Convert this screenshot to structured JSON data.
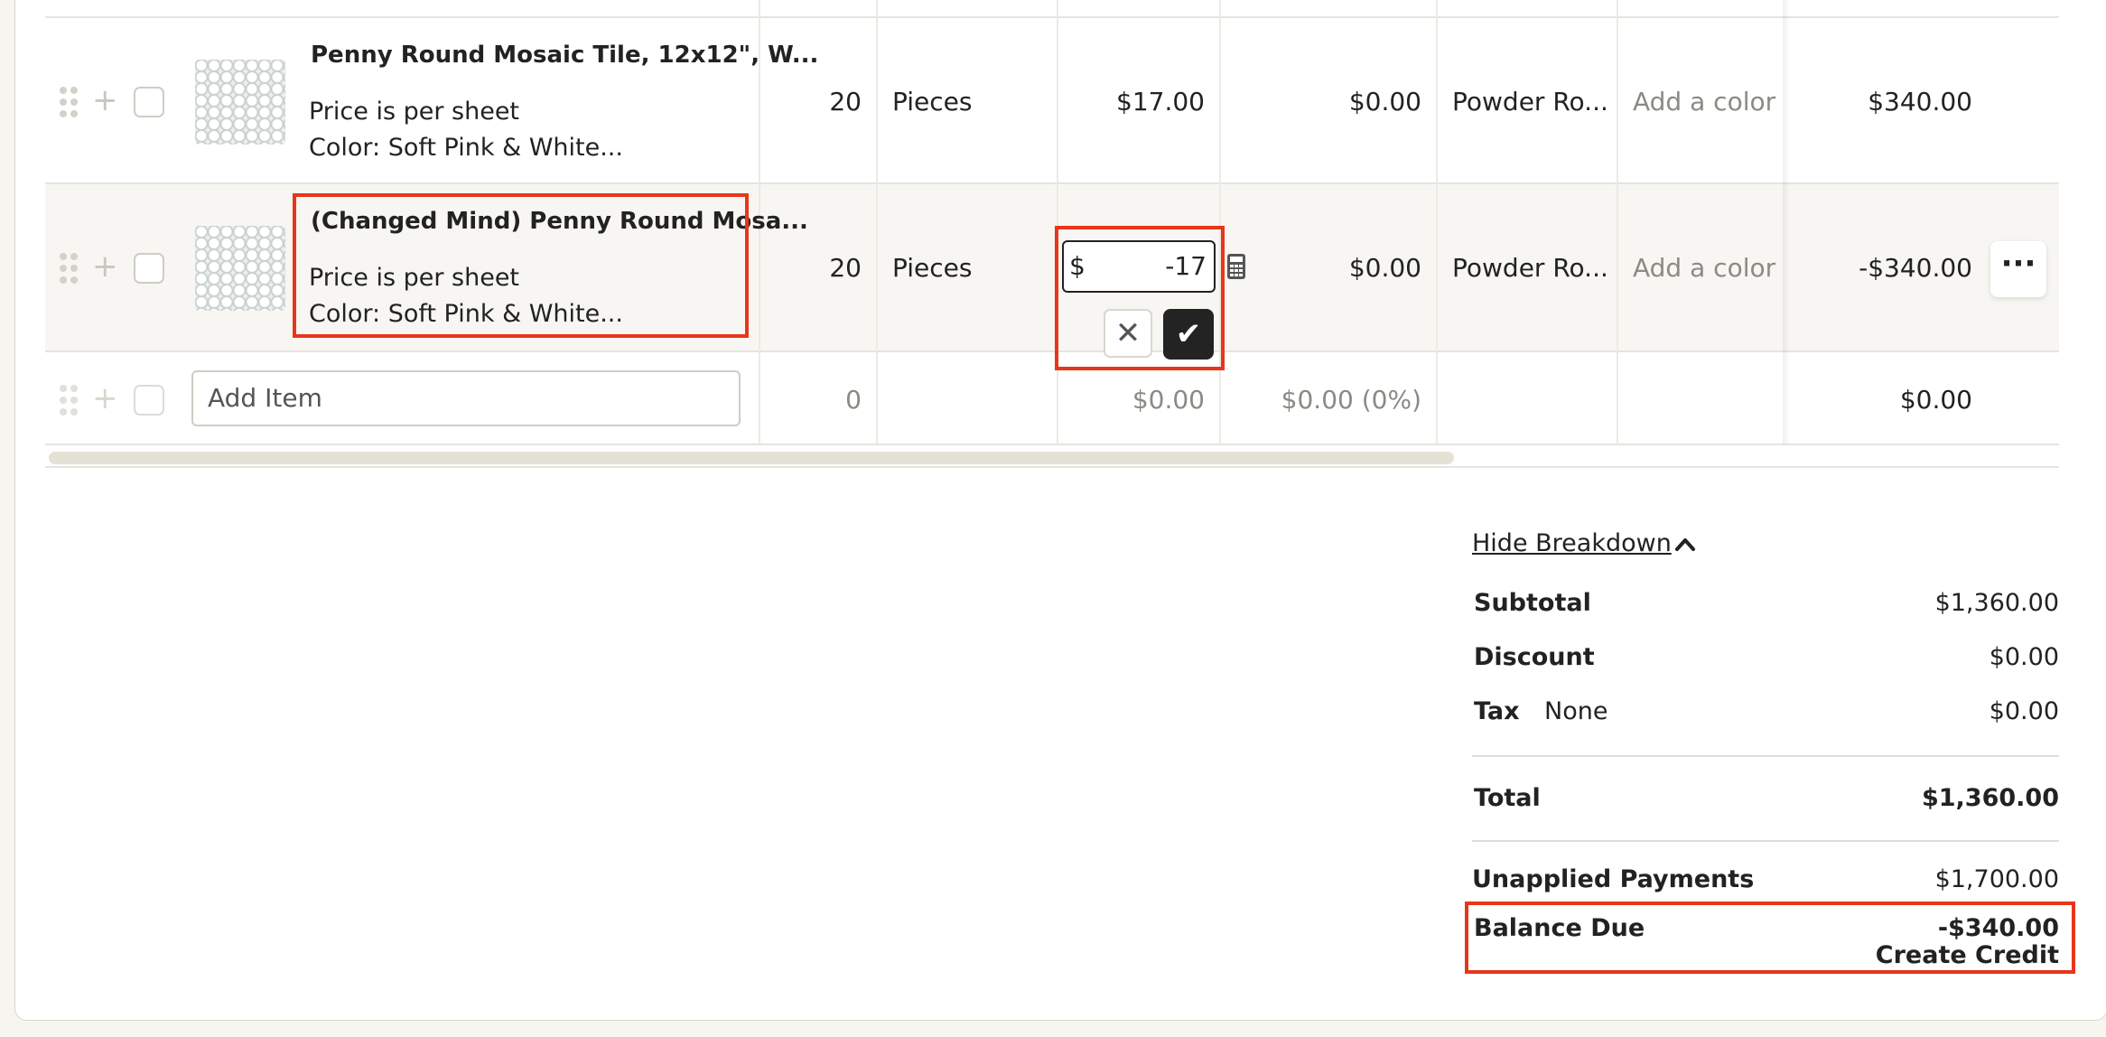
{
  "rows": [
    {
      "title": "Penny Round Mosaic Tile, 12x12\", W...",
      "desc1": "Price is per sheet",
      "desc2": "Color: Soft Pink & White...",
      "qty": "20",
      "unit": "Pieces",
      "price": "$17.00",
      "discount": "$0.00",
      "room": "Powder Ro...",
      "color": "Add a color",
      "total": "$340.00"
    },
    {
      "title": "(Changed Mind) Penny Round Mosa...",
      "desc1": "Price is per sheet",
      "desc2": "Color: Soft Pink & White...",
      "qty": "20",
      "unit": "Pieces",
      "price_prefix": "$",
      "price_value": "-17",
      "discount": "$0.00",
      "room": "Powder Ro...",
      "color": "Add a color",
      "total": "-$340.00"
    }
  ],
  "add_row": {
    "placeholder": "Add Item",
    "qty": "0",
    "price": "$0.00",
    "discount": "$0.00 (0%)",
    "total": "$0.00"
  },
  "summary": {
    "toggle": "Hide Breakdown",
    "subtotal_label": "Subtotal",
    "subtotal": "$1,360.00",
    "discount_label": "Discount",
    "discount": "$0.00",
    "tax_label": "Tax",
    "tax_type": "None",
    "tax": "$0.00",
    "total_label": "Total",
    "total": "$1,360.00",
    "unapplied_label": "Unapplied Payments",
    "unapplied": "$1,700.00",
    "balance_label": "Balance Due",
    "balance": "-$340.00",
    "create_credit": "Create Credit"
  },
  "colors": {
    "highlight": "#e8361a",
    "confirm": "#232323"
  },
  "icons": [
    "drag-handle-icon",
    "plus-icon",
    "calculator-icon",
    "close-icon",
    "check-icon",
    "more-icon",
    "chevron-up-icon"
  ]
}
